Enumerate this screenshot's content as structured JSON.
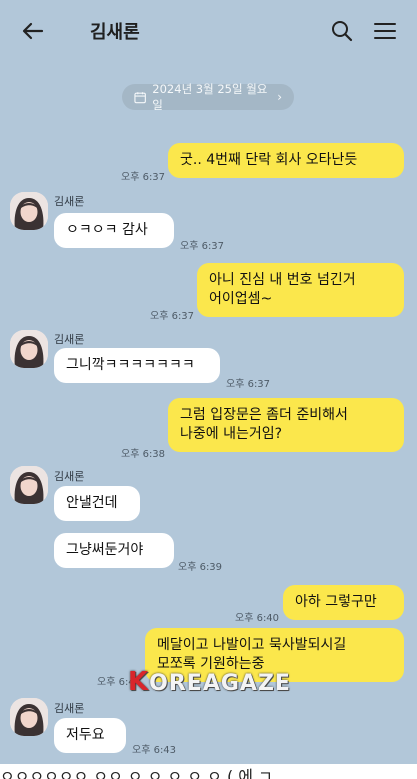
{
  "header": {
    "title": "김새론",
    "icons": {
      "back": "arrow-left-icon",
      "search": "search-icon",
      "menu": "hamburger-menu-icon"
    }
  },
  "date_chip": {
    "text": "2024년 3월 25일 월요일",
    "icon": "calendar-icon",
    "chevron": "›"
  },
  "sender_name": "김새론",
  "messages": [
    {
      "from": "me",
      "text": "굿.. 4번째 단락 회사 오타난듯",
      "time": "오후 6:37"
    },
    {
      "from": "them",
      "text": "ㅇㅋㅇㅋ 감사",
      "time": "오후 6:37"
    },
    {
      "from": "me",
      "lines": [
        "아니 진심 내 번호 넘긴거",
        "어이업셈~"
      ],
      "time": "오후 6:37"
    },
    {
      "from": "them",
      "text": "그니깍ㅋㅋㅋㅋㅋㅋㅋ",
      "time": "오후 6:37"
    },
    {
      "from": "me",
      "lines": [
        "그럼 입장문은 좀더 준비해서",
        "나중에 내는거임?"
      ],
      "time": "오후 6:38"
    },
    {
      "from": "them",
      "text": "안낼건데",
      "time": ""
    },
    {
      "from": "them",
      "text": "그냥써둔거야",
      "time": "오후 6:39"
    },
    {
      "from": "me",
      "text": "아하 그렇구만",
      "time": "오후 6:40"
    },
    {
      "from": "me",
      "lines": [
        "메달이고 나발이고 묵사발되시길",
        "모쪼록 기원하는중"
      ],
      "time": "오후 6:4"
    },
    {
      "from": "them",
      "text": "저두요",
      "time": "오후 6:43"
    }
  ],
  "watermark": {
    "k": "K",
    "rest": "OREAGAZE"
  },
  "bottom_strip_text": "ㅇㅇㅇㅇㅇㅇ ㅇㅇ ㅇ ㅇ ㅇ ㅇ ㅇ ( 에 ㄱ",
  "colors": {
    "background": "#b2c7d9",
    "my_bubble": "#fbe74c",
    "their_bubble": "#ffffff"
  }
}
